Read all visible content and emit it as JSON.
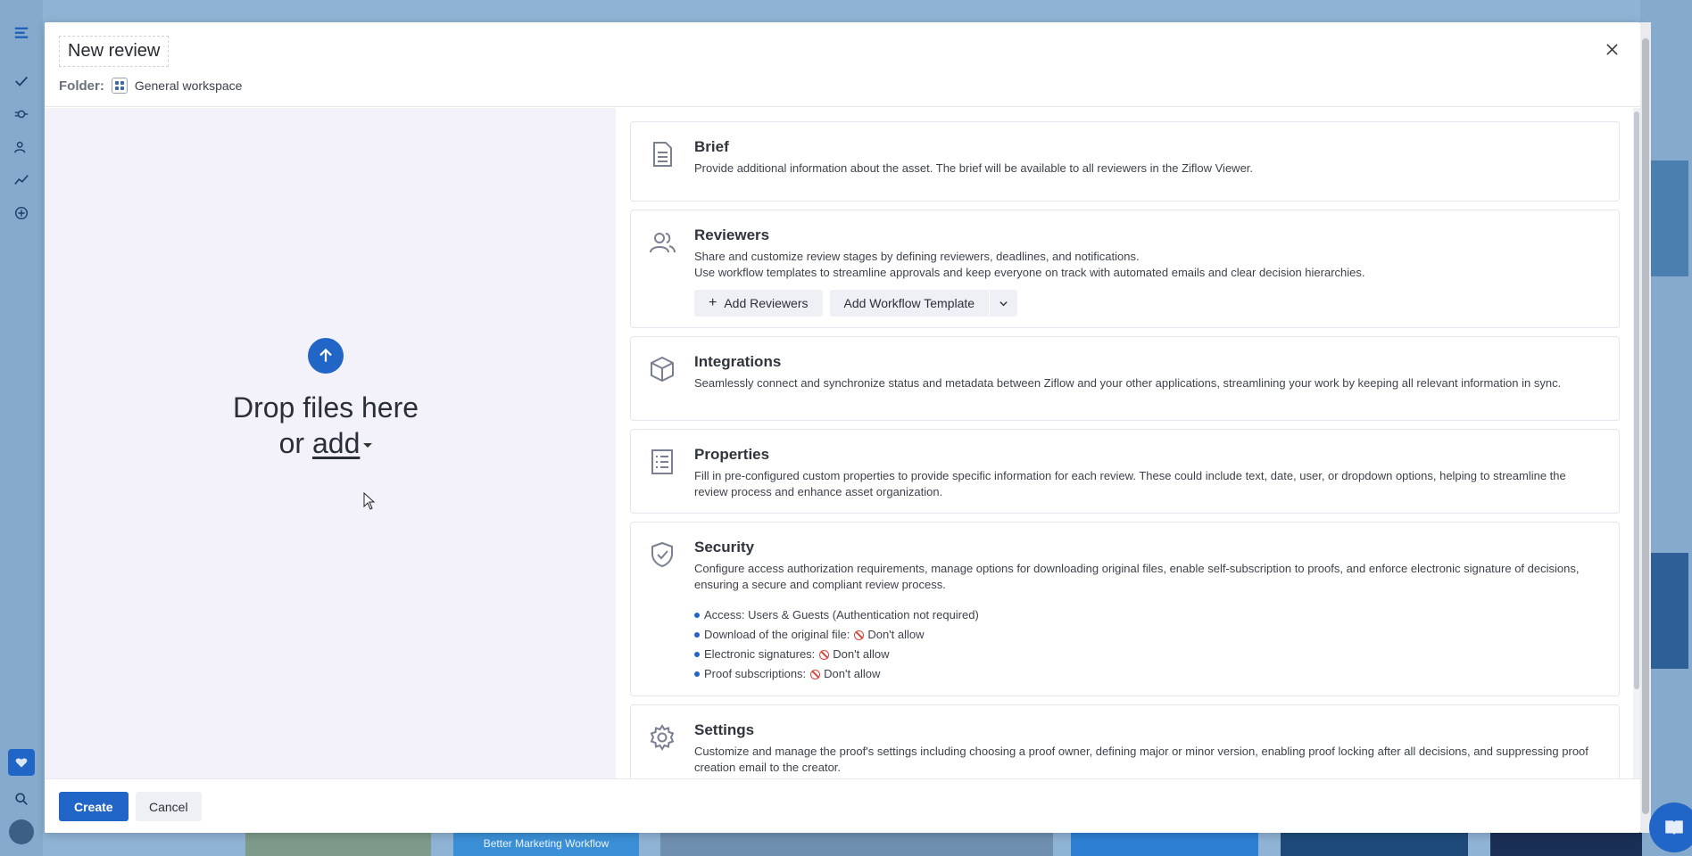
{
  "modal": {
    "title": "New review",
    "folder_label": "Folder:",
    "folder_name": "General workspace"
  },
  "dropzone": {
    "line1": "Drop files here",
    "line2_prefix": "or ",
    "add_link": "add"
  },
  "panels": {
    "brief": {
      "title": "Brief",
      "desc": "Provide additional information about the asset. The brief will be available to all reviewers in the Ziflow Viewer.",
      "icon": "document-icon"
    },
    "reviewers": {
      "title": "Reviewers",
      "desc1": "Share and customize review stages by defining reviewers, deadlines, and notifications.",
      "desc2": "Use workflow templates to streamline approvals and keep everyone on track with automated emails and clear decision hierarchies.",
      "add_reviewers": "Add Reviewers",
      "add_workflow": "Add Workflow Template",
      "icon": "users-icon"
    },
    "integrations": {
      "title": "Integrations",
      "desc": "Seamlessly connect and synchronize status and metadata between Ziflow and your other applications, streamlining your work by keeping all relevant information in sync.",
      "icon": "cube-icon"
    },
    "properties": {
      "title": "Properties",
      "desc": "Fill in pre-configured custom properties to provide specific information for each review. These could include text, date, user, or dropdown options, helping to streamline the review process and enhance asset organization.",
      "icon": "list-document-icon"
    },
    "security": {
      "title": "Security",
      "desc": "Configure access authorization requirements, manage options for downloading original files, enable self-subscription to proofs, and enforce electronic signature of decisions, ensuring a secure and compliant review process.",
      "access": "Access: Users & Guests (Authentication not required)",
      "download_label": "Download of the original file:",
      "download_value": "Don't allow",
      "esign_label": "Electronic signatures:",
      "esign_value": "Don't allow",
      "subs_label": "Proof subscriptions:",
      "subs_value": "Don't allow",
      "icon": "shield-check-icon"
    },
    "settings": {
      "title": "Settings",
      "desc": "Customize and manage the proof's settings including choosing a proof owner, defining major or minor version, enabling proof locking after all decisions, and suppressing proof creation email to the creator.",
      "icon": "gear-icon"
    }
  },
  "footer": {
    "create": "Create",
    "cancel": "Cancel"
  },
  "background": {
    "caption": "Better Marketing Workflow"
  },
  "colors": {
    "primary": "#2166c6",
    "deny": "#d9453b",
    "drop_bg": "#f3f2fb"
  }
}
